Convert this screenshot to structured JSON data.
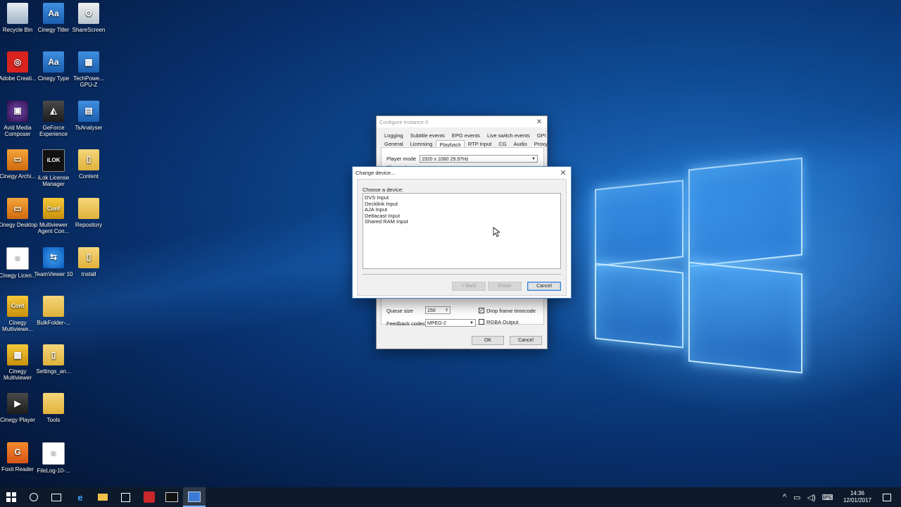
{
  "desktop": {
    "icons": [
      {
        "label": "Recycle Bin",
        "glyph": ""
      },
      {
        "label": "Cinegy Titler",
        "glyph": "Aa"
      },
      {
        "label": "ShareScreen",
        "glyph": "⚙"
      },
      {
        "label": "Adobe Creati...",
        "glyph": "◎"
      },
      {
        "label": "Cinegy Type",
        "glyph": "Aa"
      },
      {
        "label": "TechPowe... GPU-Z",
        "glyph": "▦"
      },
      {
        "label": "Avid Media Composer",
        "glyph": "▣"
      },
      {
        "label": "GeForce Experience",
        "glyph": "◭"
      },
      {
        "label": "TsAnalyser",
        "glyph": "▤"
      },
      {
        "label": "Cinegy Archi...",
        "glyph": "▭"
      },
      {
        "label": "iLok License Manager",
        "glyph": "iLOK"
      },
      {
        "label": "Content",
        "glyph": "▯"
      },
      {
        "label": "Cinegy Desktop",
        "glyph": "▭"
      },
      {
        "label": "Multiviewer Agent Con...",
        "glyph": "Conf"
      },
      {
        "label": "Repository",
        "glyph": ""
      },
      {
        "label": "Cinegy Licen...",
        "glyph": "≡"
      },
      {
        "label": "TeamViewer 10",
        "glyph": "⇆"
      },
      {
        "label": "Install",
        "glyph": "▯"
      },
      {
        "label": "Cinegy Multiviewe...",
        "glyph": "Conf"
      },
      {
        "label": "BulkFolder-...",
        "glyph": ""
      },
      {
        "label": "Cinegy Multiviewer",
        "glyph": "▦"
      },
      {
        "label": "Settings_an...",
        "glyph": "▯"
      },
      {
        "label": "Cinegy Player",
        "glyph": "▶"
      },
      {
        "label": "Tools",
        "glyph": ""
      },
      {
        "label": "Foxit Reader",
        "glyph": "G"
      },
      {
        "label": "FileLog-10-...",
        "glyph": "≡"
      }
    ]
  },
  "config_window": {
    "title": "Configure Instance 0",
    "tabs_row1": [
      "Logging",
      "Subtitle events",
      "EPG events",
      "Live switch events",
      "GPI"
    ],
    "tabs_row2": [
      "General",
      "Licensing",
      "Playback",
      "RTP Input",
      "CG",
      "Audio",
      "Proxy"
    ],
    "active_tab": "Playback",
    "player_mode_label": "Player mode",
    "player_mode_value": "1920 x 1080 29.97Hz",
    "channels_label": "Channels",
    "queue_size_label": "Queue size",
    "queue_size_value": "150",
    "feedback_codec_label": "Feedback codec",
    "feedback_codec_value": "MPEG-2",
    "drop_frame_label": "Drop frame timecode",
    "drop_frame_checked": true,
    "rgba_label": "RGBA Output",
    "rgba_checked": false,
    "ok_label": "OK",
    "cancel_label": "Cancel"
  },
  "change_device": {
    "title": "Change device...",
    "prompt": "Choose a device:",
    "devices": [
      "DVS Input",
      "Decklink Input",
      "AJA Input",
      "Deltacast Input",
      "Shared RAM Input"
    ],
    "back_label": "< Back",
    "finish_label": "Finish",
    "cancel_label": "Cancel"
  },
  "taskbar": {
    "time": "14:36",
    "date": "12/01/2017"
  },
  "colors": {
    "accent": "#3c7fd1",
    "taskbar": "#0c1a2c"
  }
}
